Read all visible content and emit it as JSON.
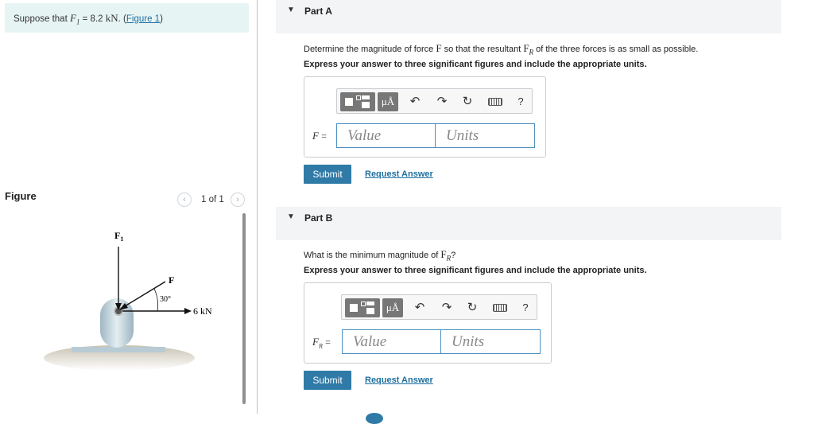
{
  "prompt": {
    "lead": "Suppose that",
    "var": "F",
    "sub": "1",
    "eq": "= 8.2",
    "unit": "kN",
    "tail": ". (",
    "link": "Figure 1",
    "close": ")"
  },
  "figure": {
    "title": "Figure",
    "pager": "1 of 1",
    "labels": {
      "f1": "F",
      "f1_sub": "1",
      "f": "F",
      "angle": "30°",
      "force": "6 kN"
    }
  },
  "parts": [
    {
      "title": "Part A",
      "question_pre": "Determine the magnitude of force",
      "question_var": "F",
      "question_mid": "so that the resultant",
      "question_var2": "F",
      "question_var2_sub": "R",
      "question_post": "of the three forces is as small as possible.",
      "instruction": "Express your answer to three significant figures and include the appropriate units.",
      "field_label": "F",
      "field_label_sub": "",
      "value_placeholder": "Value",
      "units_placeholder": "Units",
      "submit": "Submit",
      "request": "Request Answer"
    },
    {
      "title": "Part B",
      "question_pre": "What is the minimum magnitude of",
      "question_var2": "F",
      "question_var2_sub": "R",
      "question_post": "?",
      "instruction": "Express your answer to three significant figures and include the appropriate units.",
      "field_label": "F",
      "field_label_sub": "R",
      "value_placeholder": "Value",
      "units_placeholder": "Units",
      "submit": "Submit",
      "request": "Request Answer"
    }
  ],
  "toolbar": {
    "units_label": "μÅ",
    "undo": "↶",
    "redo": "↷",
    "reset": "↻",
    "help": "?"
  },
  "icons": {
    "templates": "templates-icon",
    "units": "units-icon",
    "undo": "undo-icon",
    "redo": "redo-icon",
    "reset": "reset-icon",
    "keyboard": "keyboard-icon",
    "help": "help-icon",
    "collapse": "collapse-triangle-icon",
    "prev": "chevron-left-icon",
    "next": "chevron-right-icon"
  },
  "colors": {
    "accent": "#2f7aa6",
    "prompt_bg": "#e7f4f4",
    "header_bg": "#f2f4f6"
  }
}
